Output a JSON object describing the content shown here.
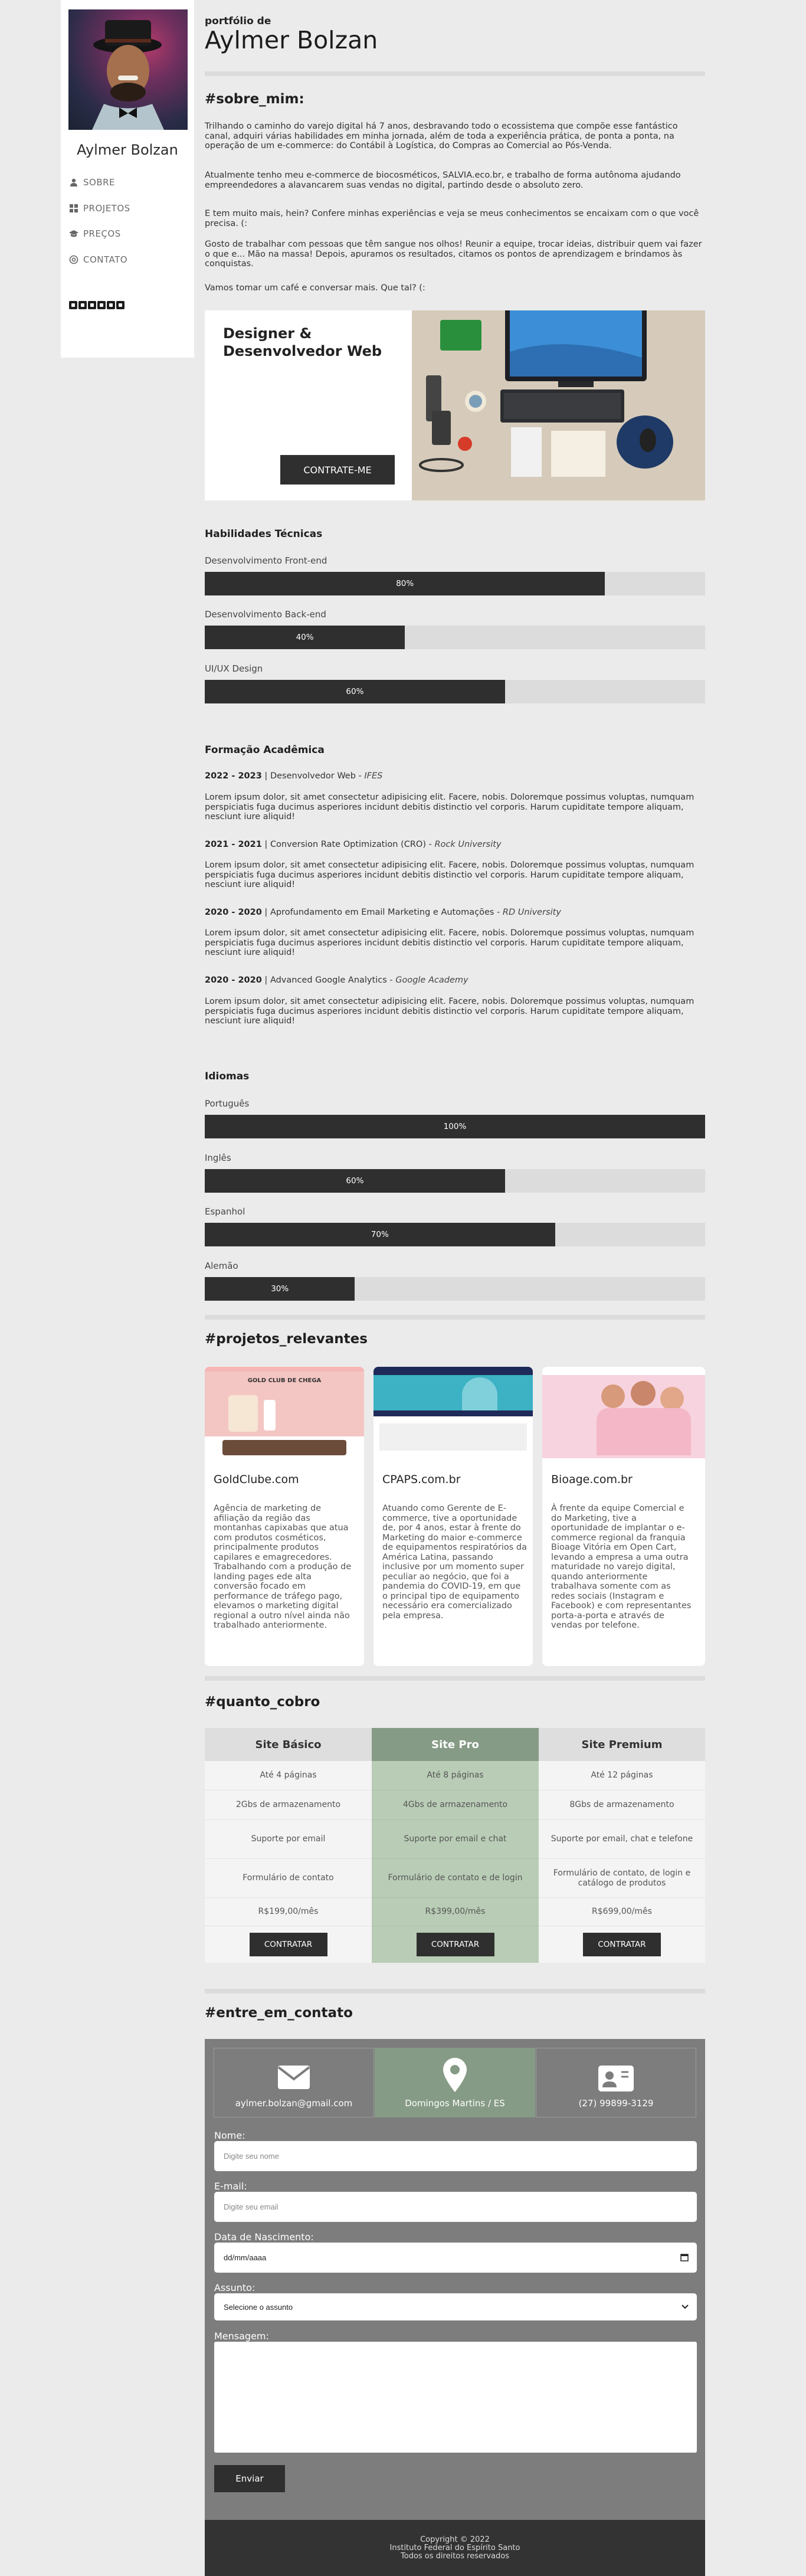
{
  "sidebar": {
    "name": "Aylmer Bolzan",
    "nav": [
      {
        "label": "SOBRE",
        "icon": "user-icon"
      },
      {
        "label": "PROJETOS",
        "icon": "grid-icon"
      },
      {
        "label": "PREÇOS",
        "icon": "graduation-cap-icon"
      },
      {
        "label": "CONTATO",
        "icon": "at-sign-icon"
      }
    ],
    "social_icons": [
      "facebook-icon",
      "instagram-icon",
      "linkedin-icon",
      "github-icon",
      "pinterest-icon",
      "twitter-icon"
    ]
  },
  "header": {
    "kicker": "portfólio de",
    "title": "Aylmer Bolzan"
  },
  "about": {
    "title": "#sobre_mim:",
    "paragraphs": [
      "Trilhando o caminho do varejo digital há 7 anos, desbravando todo o ecossistema que compõe esse fantástico canal, adquiri várias habilidades em minha jornada, além de toda a experiência prática, de ponta a ponta, na operação de um e-commerce: do Contábil à Logística, do Compras ao Comercial ao Pós-Venda.",
      "Atualmente tenho meu e-commerce de biocosméticos, SALVIA.eco.br, e trabalho de forma autônoma ajudando empreendedores a alavancarem suas vendas no digital, partindo desde o absoluto zero.",
      "E tem muito mais, hein? Confere minhas experiências e veja se meus conhecimentos se encaixam com o que você precisa. (:",
      "Gosto de trabalhar com pessoas que têm sangue nos olhos! Reunir a equipe, trocar ideias, distribuir quem vai fazer o que e... Mão na massa! Depois, apuramos os resultados, citamos os pontos de aprendizagem e brindamos às conquistas.",
      "Vamos tomar um café e conversar mais. Que tal? (:"
    ]
  },
  "hero": {
    "role_line1": "Designer &",
    "role_line2": "Desenvolvedor Web",
    "cta": "CONTRATE-ME"
  },
  "skills": {
    "title": "Habilidades Técnicas",
    "items": [
      {
        "label": "Desenvolvimento Front-end",
        "value": 80,
        "text": "80%"
      },
      {
        "label": "Desenvolvimento Back-end",
        "value": 40,
        "text": "40%"
      },
      {
        "label": "UI/UX Design",
        "value": 60,
        "text": "60%"
      }
    ]
  },
  "education": {
    "title": "Formação Acadêmica",
    "items": [
      {
        "years": "2022 - 2023",
        "course": "Desenvolvedor Web",
        "school": "IFES",
        "text": "Lorem ipsum dolor, sit amet consectetur adipisicing elit. Facere, nobis. Doloremque possimus voluptas, numquam perspiciatis fuga ducimus asperiores incidunt debitis distinctio vel corporis. Harum cupiditate tempore aliquam, nesciunt iure aliquid!"
      },
      {
        "years": "2021 - 2021",
        "course": "Conversion Rate Optimization (CRO)",
        "school": "Rock University",
        "text": "Lorem ipsum dolor, sit amet consectetur adipisicing elit. Facere, nobis. Doloremque possimus voluptas, numquam perspiciatis fuga ducimus asperiores incidunt debitis distinctio vel corporis. Harum cupiditate tempore aliquam, nesciunt iure aliquid!"
      },
      {
        "years": "2020 - 2020",
        "course": "Aprofundamento em Email Marketing e Automações",
        "school": "RD University",
        "text": "Lorem ipsum dolor, sit amet consectetur adipisicing elit. Facere, nobis. Doloremque possimus voluptas, numquam perspiciatis fuga ducimus asperiores incidunt debitis distinctio vel corporis. Harum cupiditate tempore aliquam, nesciunt iure aliquid!"
      },
      {
        "years": "2020 - 2020",
        "course": "Advanced Google Analytics",
        "school": "Google Academy",
        "text": "Lorem ipsum dolor, sit amet consectetur adipisicing elit. Facere, nobis. Doloremque possimus voluptas, numquam perspiciatis fuga ducimus asperiores incidunt debitis distinctio vel corporis. Harum cupiditate tempore aliquam, nesciunt iure aliquid!"
      }
    ]
  },
  "languages": {
    "title": "Idiomas",
    "items": [
      {
        "label": "Português",
        "value": 100,
        "text": "100%"
      },
      {
        "label": "Inglês",
        "value": 60,
        "text": "60%"
      },
      {
        "label": "Espanhol",
        "value": 70,
        "text": "70%"
      },
      {
        "label": "Alemão",
        "value": 30,
        "text": "30%"
      }
    ]
  },
  "projects": {
    "title": "#projetos_relevantes",
    "items": [
      {
        "name": "GoldClube.com",
        "banner": "GOLD CLUB DE CHEGA",
        "text": "Agência de marketing de afiliação da região das montanhas capixabas que atua com produtos cosméticos, principalmente produtos capilares e emagrecedores. Trabalhando com a produção de landing pages ede alta conversão focado em performance de tráfego pago, elevamos o marketing digital regional a outro nível ainda não trabalhado anteriormente."
      },
      {
        "name": "CPAPS.com.br",
        "text": "Atuando como Gerente de E-commerce, tive a oportunidade de, por 4 anos, estar à frente do Marketing do maior e-commerce de equipamentos respiratórios da América Latina, passando inclusive por um momento super peculiar ao negócio, que foi a pandemia do COVID-19, em que o principal tipo de equipamento necessário era comercializado pela empresa."
      },
      {
        "name": "Bioage.com.br",
        "text": "À frente da equipe Comercial e do Marketing, tive a oportunidade de implantar o e-commerce regional da franquia Bioage Vitória em Open Cart, levando a empresa a uma outra maturidade no varejo digital, quando anteriormente trabalhava somente com as redes sociais (Instagram e Facebook) e com representantes porta-a-porta e através de vendas por telefone."
      }
    ]
  },
  "pricing": {
    "title": "#quanto_cobro",
    "plans": [
      {
        "name": "Site Básico",
        "pages": "Até 4 páginas",
        "storage": "2Gbs de armazenamento",
        "support": "Suporte por email",
        "form": "Formulário de contato",
        "price": "R$199,00/mês",
        "cta": "CONTRATAR"
      },
      {
        "name": "Site Pro",
        "pages": "Até 8 páginas",
        "storage": "4Gbs de armazenamento",
        "support": "Suporte por email e chat",
        "form": "Formulário de contato e de login",
        "price": "R$399,00/mês",
        "cta": "CONTRATAR"
      },
      {
        "name": "Site Premium",
        "pages": "Até 12 páginas",
        "storage": "8Gbs de armazenamento",
        "support": "Suporte por email, chat e telefone",
        "form": "Formulário de contato, de login e catálogo de produtos",
        "price": "R$699,00/mês",
        "cta": "CONTRATAR"
      }
    ],
    "colors": {
      "highlight_head": "#869b86",
      "highlight_body": "#b9cdb6",
      "plain_head": "#dedede",
      "plain_body": "#f4f4f4"
    }
  },
  "contact": {
    "title": "#entre_em_contato",
    "email": "aylmer.bolzan@gmail.com",
    "location": "Domingos Martins / ES",
    "phone": "(27) 99899-3129",
    "form": {
      "name_label": "Nome:",
      "name_placeholder": "Digite seu nome",
      "email_label": "E-mail:",
      "email_placeholder": "Digite seu email",
      "birth_label": "Data de Nascimento:",
      "birth_placeholder": "dd/mm/aaaa",
      "subject_label": "Assunto:",
      "subject_selected": "Selecione o assunto",
      "message_label": "Mensagem:",
      "submit": "Enviar"
    }
  },
  "footer": {
    "line1": "Copyright © 2022",
    "line2": "Instituto Federal do Espírito Santo",
    "line3": "Todos os direitos reservados"
  }
}
